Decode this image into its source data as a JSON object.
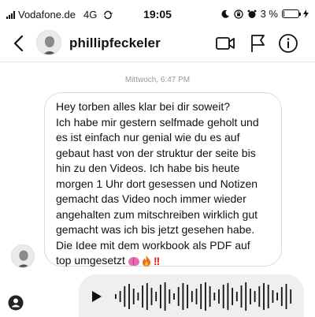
{
  "status_bar": {
    "carrier": "Vodafone.de",
    "network": "4G",
    "time": "19:05",
    "battery_percent": "3 %",
    "battery_level": 0.03
  },
  "header": {
    "username": "phillipfeckeler",
    "icons": [
      "back-chevron-icon",
      "video-camera-icon",
      "flag-icon",
      "info-icon"
    ]
  },
  "conversation": {
    "timestamp": "Mittwoch, 6:47 PM",
    "message_lines": [
      "Hey torben alles klar bei dir soweit?",
      "Ich habe mir gestern selfmade geholt und",
      "es ist einfach nur genial wie du es auf",
      "gebaut hast von der struktur der seite bis",
      "hin zu den Videos. Ich habe bis heute",
      "morgen 1 Uhr dort gesessen und Notizen",
      "gemacht das Video noch immer wieder",
      "angehalten zum mitschreiben wirklich gut",
      "gemacht was ich bis jetzt gesehen habe.",
      "Die Idee mit dem workbook als PDF auf",
      "top umgesetzt"
    ],
    "emojis": [
      "brain",
      "fire"
    ],
    "exclamation": "!!"
  },
  "voice_message": {
    "icons": [
      "play-icon",
      "waveform"
    ]
  },
  "colors": {
    "bubble_border": "#dbdbdb",
    "voice_bg": "#efefef",
    "timestamp": "#999999",
    "exclamation": "#d91a1a"
  }
}
